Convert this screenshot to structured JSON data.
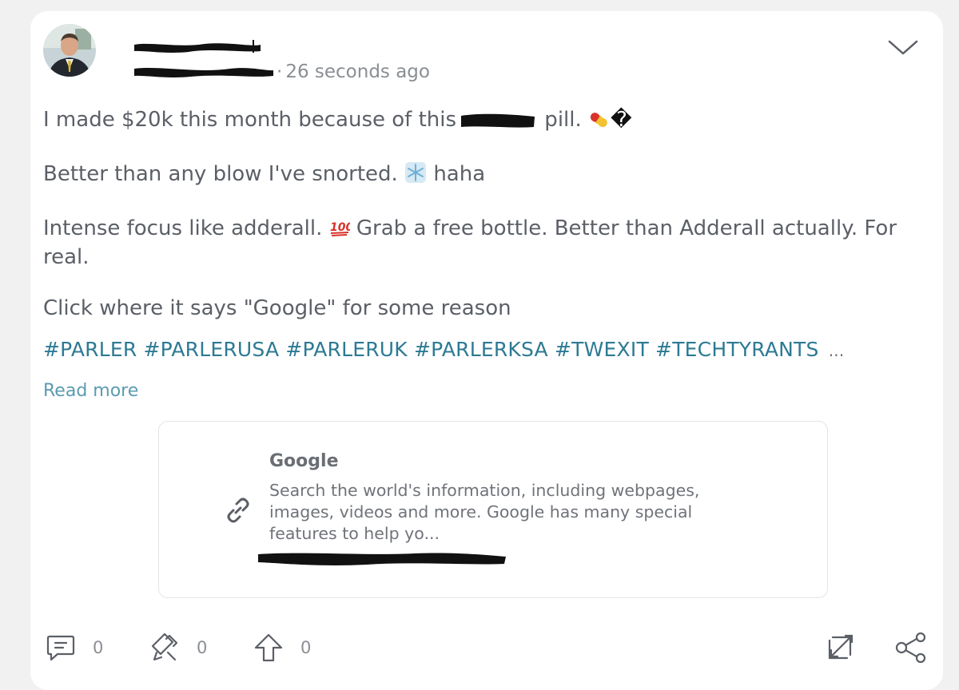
{
  "post": {
    "timestamp": "26 seconds ago",
    "handle_separator": "·",
    "paragraphs": {
      "p1_before": "I made $20k this month because of this",
      "p1_after": " pill. ",
      "p1_glyph": "�",
      "p2_before": "Better than any blow I've snorted. ",
      "p2_after": " haha",
      "p3_before": "Intense focus like adderall. ",
      "p3_after": " Grab a free bottle. Better than Adderall actually. For real.",
      "p4": "Click where it says \"Google\" for some reason"
    },
    "hashtags": "#PARLER #PARLERUSA #PARLERUK #PARLERKSA #TWEXIT #TECHTYRANTS",
    "hashtags_ellipsis": "...",
    "read_more": "Read more"
  },
  "link_preview": {
    "title": "Google",
    "description": "Search the world's information, including webpages, images, videos and more. Google has many special features to help yo..."
  },
  "actions": {
    "comments_count": "0",
    "echoes_count": "0",
    "upvotes_count": "0"
  },
  "icons": {
    "menu": "chevron-down-icon",
    "comment": "comment-icon",
    "echo": "echo-icon",
    "upvote": "upvote-icon",
    "expand": "expand-icon",
    "share": "share-icon",
    "link": "link-icon"
  },
  "colors": {
    "hashtag": "#2d7a93",
    "read_more": "#5b9bb1",
    "text": "#5b5f66",
    "muted": "#8a8e94"
  }
}
